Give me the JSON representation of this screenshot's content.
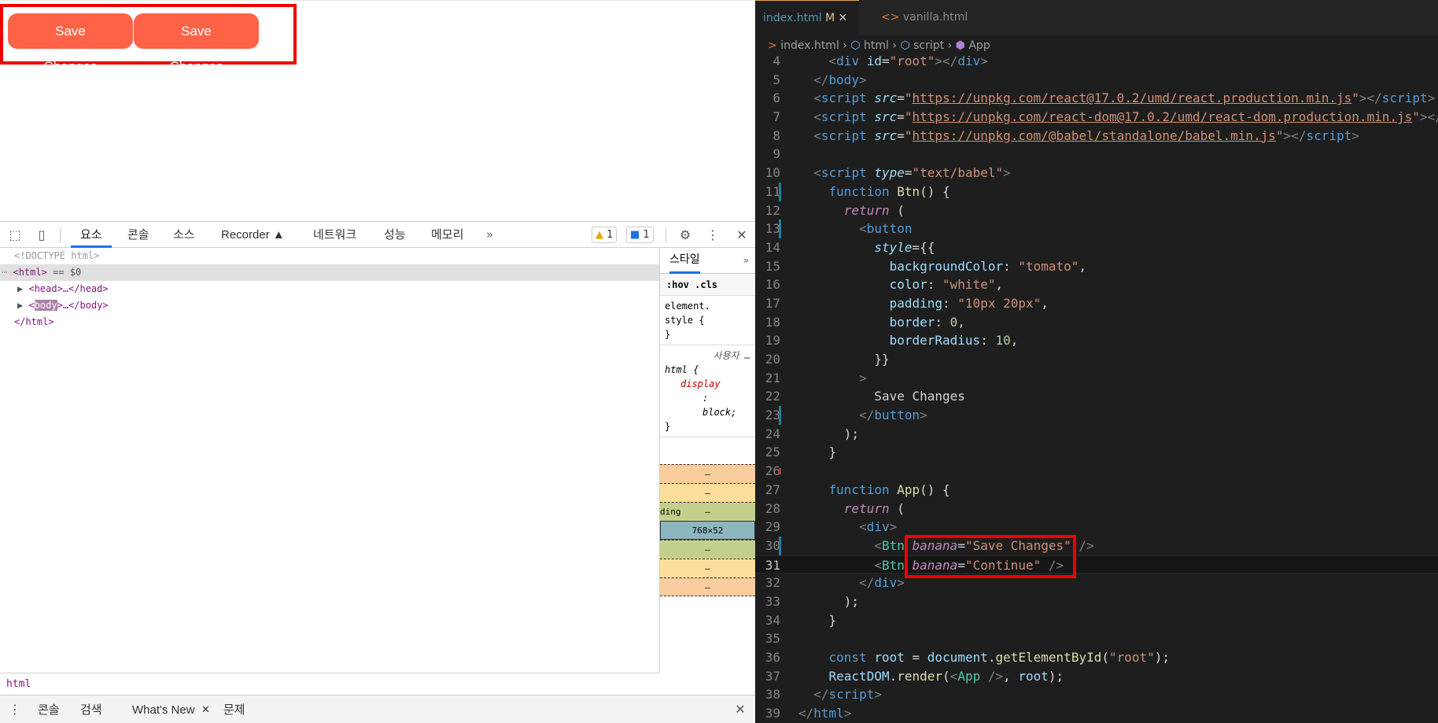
{
  "browser": {
    "buttons": [
      "Save Changes",
      "Save Changes"
    ],
    "button_color": "#ff6347",
    "highlight_color": "#ee0000"
  },
  "devtools": {
    "tabs": [
      "요소",
      "콘솔",
      "소스",
      "Recorder ▲",
      "네트워크",
      "성능",
      "메모리",
      "»"
    ],
    "active_tab": "요소",
    "warning_count": "1",
    "message_count": "1",
    "tree": {
      "doctype": "<!DOCTYPE html>",
      "html_open": "<html>",
      "selected_marker": "== $0",
      "head": "<head>…</head>",
      "body_open": "<",
      "body_tag": "body",
      "body_close": ">…</body>",
      "html_close": "</html>"
    },
    "styles": {
      "tab": "스타일",
      "more": "»",
      "filter": ":hov .cls",
      "rule1_selector": "element.",
      "rule1_style": "style {",
      "rule1_close": "}",
      "rule2_origin": "사용자 …",
      "rule2_selector": "html {",
      "rule2_prop": "display",
      "rule2_colon": ":",
      "rule2_value": "block;",
      "rule2_close": "}",
      "box_rows": [
        "–",
        "–",
        "–",
        "768×52",
        "–",
        "–",
        "–"
      ],
      "padding_label": "ding"
    },
    "breadcrumb": "html",
    "drawer_tabs": [
      "콘솔",
      "검색",
      "What's New",
      "문제"
    ]
  },
  "editor": {
    "tabs": [
      {
        "label": "index.html",
        "status": "M",
        "active": true
      },
      {
        "label": "vanilla.html",
        "active": false
      }
    ],
    "breadcrumbs": [
      "index.html",
      "html",
      "script",
      "App"
    ],
    "first_line_number": 4
  }
}
